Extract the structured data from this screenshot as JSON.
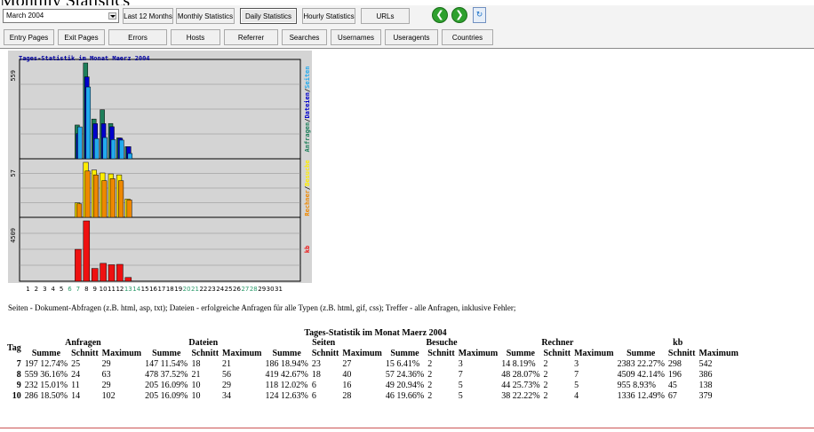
{
  "page": {
    "title": "Monthly Statistics"
  },
  "toolbar1": {
    "month_select": "March 2004",
    "buttons": [
      "Last 12 Months",
      "Monthly Statistics",
      "Daily Statistics",
      "Hourly Statistics",
      "URLs"
    ],
    "active": "Daily Statistics",
    "icons": [
      "back-icon",
      "forward-icon",
      "refresh-icon"
    ]
  },
  "toolbar2": {
    "buttons": [
      "Entry Pages",
      "Exit Pages",
      "Errors",
      "Hosts",
      "Referrer",
      "Searches",
      "Usernames",
      "Useragents",
      "Countries"
    ]
  },
  "chart": {
    "caption": "Tages-Statistik im Monat Maerz 2004",
    "panel1_max": "559",
    "panel2_max": "57",
    "panel3_max": "4509",
    "panel1_legend": [
      "Anfragen",
      "/",
      "Dateien",
      "/",
      "Seiten"
    ],
    "panel2_legend": [
      "Rechner",
      "/",
      "Besuche"
    ],
    "panel3_legend": "kb",
    "colors": {
      "anfragen": "#1e7f5a",
      "dateien": "#0000cc",
      "seiten": "#22aaee",
      "rechner": "#ee8800",
      "besuche": "#ffee00",
      "kb": "#ee1111",
      "weekend": "#2a9a6a"
    },
    "days": [
      "1",
      "2",
      "3",
      "4",
      "5",
      "6",
      "7",
      "8",
      "9",
      "10",
      "11",
      "12",
      "13",
      "14",
      "15",
      "16",
      "17",
      "18",
      "19",
      "20",
      "21",
      "22",
      "23",
      "24",
      "25",
      "26",
      "27",
      "28",
      "29",
      "30",
      "31"
    ],
    "weekend_days": [
      "6",
      "7",
      "13",
      "14",
      "20",
      "21",
      "27",
      "28"
    ]
  },
  "chart_data": {
    "type": "bar",
    "title": "Tages-Statistik im Monat Maerz 2004",
    "categories": [
      "1",
      "2",
      "3",
      "4",
      "5",
      "6",
      "7",
      "8",
      "9",
      "10",
      "11",
      "12",
      "13",
      "14",
      "15",
      "16",
      "17",
      "18",
      "19",
      "20",
      "21",
      "22",
      "23",
      "24",
      "25",
      "26",
      "27",
      "28",
      "29",
      "30",
      "31"
    ],
    "series": [
      {
        "name": "Anfragen",
        "panel": 1,
        "values": [
          0,
          0,
          0,
          0,
          0,
          0,
          197,
          559,
          232,
          286,
          206,
          122,
          71,
          0,
          0,
          0,
          0,
          0,
          0,
          0,
          0,
          0,
          0,
          0,
          0,
          0,
          0,
          0,
          0,
          0,
          0
        ]
      },
      {
        "name": "Dateien",
        "panel": 1,
        "values": [
          0,
          0,
          0,
          0,
          0,
          0,
          147,
          478,
          205,
          205,
          187,
          120,
          71,
          0,
          0,
          0,
          0,
          0,
          0,
          0,
          0,
          0,
          0,
          0,
          0,
          0,
          0,
          0,
          0,
          0,
          0
        ]
      },
      {
        "name": "Seiten",
        "panel": 1,
        "values": [
          0,
          0,
          0,
          0,
          0,
          0,
          186,
          419,
          118,
          124,
          112,
          109,
          31,
          0,
          0,
          0,
          0,
          0,
          0,
          0,
          0,
          0,
          0,
          0,
          0,
          0,
          0,
          0,
          0,
          0,
          0
        ]
      },
      {
        "name": "Besuche",
        "panel": 2,
        "values": [
          0,
          0,
          0,
          0,
          0,
          0,
          15,
          57,
          49,
          46,
          45,
          44,
          19,
          0,
          0,
          0,
          0,
          0,
          0,
          0,
          0,
          0,
          0,
          0,
          0,
          0,
          0,
          0,
          0,
          0,
          0
        ]
      },
      {
        "name": "Rechner",
        "panel": 2,
        "values": [
          0,
          0,
          0,
          0,
          0,
          0,
          14,
          48,
          44,
          38,
          40,
          38,
          18,
          0,
          0,
          0,
          0,
          0,
          0,
          0,
          0,
          0,
          0,
          0,
          0,
          0,
          0,
          0,
          0,
          0,
          0
        ]
      },
      {
        "name": "kb",
        "panel": 3,
        "values": [
          0,
          0,
          0,
          0,
          0,
          0,
          2383,
          4509,
          955,
          1336,
          1230,
          1260,
          280,
          0,
          0,
          0,
          0,
          0,
          0,
          0,
          0,
          0,
          0,
          0,
          0,
          0,
          0,
          0,
          0,
          0,
          0
        ]
      }
    ],
    "ylim_panel1": [
      0,
      559
    ],
    "ylim_panel2": [
      0,
      57
    ],
    "ylim_panel3": [
      0,
      4509
    ]
  },
  "legend_text": "Seiten - Dokument-Abfragen (z.B. html, asp, txt); Dateien - erfolgreiche Anfragen für alle Typen (z.B. html, gif, css); Treffer - alle Anfragen, inklusive Fehler;",
  "table": {
    "title": "Tages-Statistik im Monat Maerz 2004",
    "tag_header": "Tag",
    "groups": [
      "Anfragen",
      "Dateien",
      "Seiten",
      "Besuche",
      "Rechner",
      "kb"
    ],
    "subheaders": [
      "Summe",
      "Schnitt",
      "Maximum"
    ],
    "rows": [
      {
        "tag": "7",
        "cells": [
          "197 12.74%",
          "25",
          "29",
          "147 11.54%",
          "18",
          "21",
          "186 18.94%",
          "23",
          "27",
          "15 6.41%",
          "2",
          "3",
          "14 8.19%",
          "2",
          "3",
          "2383 22.27%",
          "298",
          "542"
        ]
      },
      {
        "tag": "8",
        "cells": [
          "559 36.16%",
          "24",
          "63",
          "478 37.52%",
          "21",
          "56",
          "419 42.67%",
          "18",
          "40",
          "57 24.36%",
          "2",
          "7",
          "48 28.07%",
          "2",
          "7",
          "4509 42.14%",
          "196",
          "386"
        ]
      },
      {
        "tag": "9",
        "cells": [
          "232 15.01%",
          "11",
          "29",
          "205 16.09%",
          "10",
          "29",
          "118 12.02%",
          "6",
          "16",
          "49 20.94%",
          "2",
          "5",
          "44 25.73%",
          "2",
          "5",
          "955 8.93%",
          "45",
          "138"
        ]
      },
      {
        "tag": "10",
        "cells": [
          "286 18.50%",
          "14",
          "102",
          "205 16.09%",
          "10",
          "34",
          "124 12.63%",
          "6",
          "28",
          "46 19.66%",
          "2",
          "5",
          "38 22.22%",
          "2",
          "4",
          "1336 12.49%",
          "67",
          "379"
        ]
      }
    ]
  }
}
